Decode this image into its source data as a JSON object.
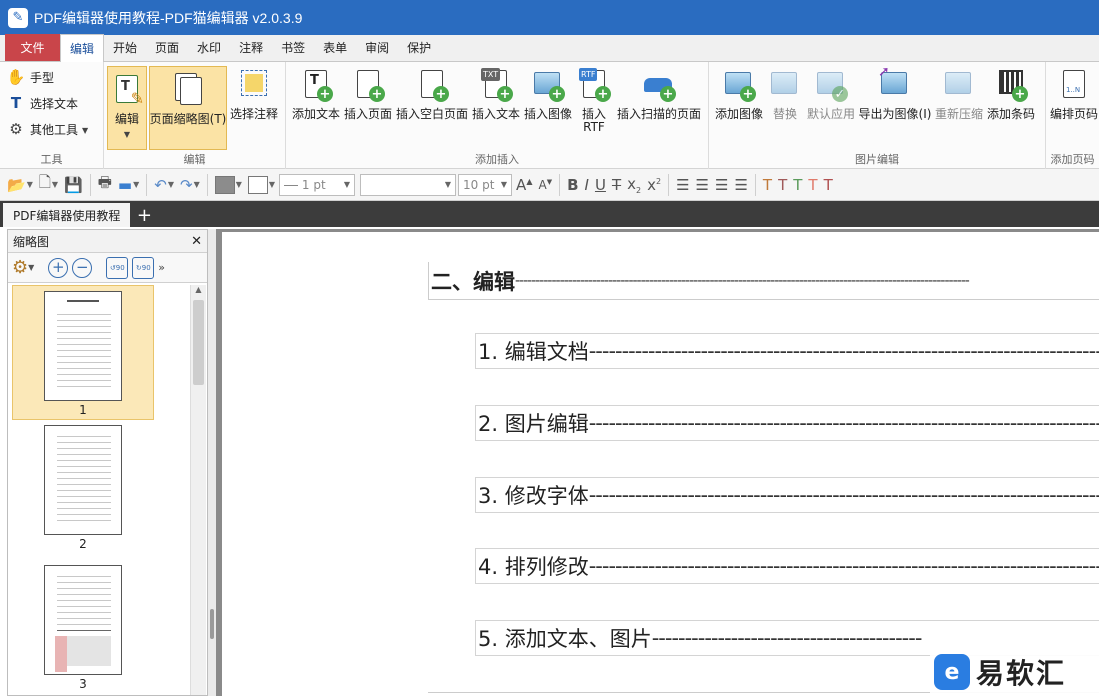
{
  "window": {
    "title": "PDF编辑器使用教程-PDF猫编辑器 v2.0.3.9"
  },
  "menu": {
    "file": "文件",
    "tabs": [
      "编辑",
      "开始",
      "页面",
      "水印",
      "注释",
      "书签",
      "表单",
      "审阅",
      "保护"
    ],
    "active": "编辑"
  },
  "ribbon": {
    "tools_group": {
      "label": "工具",
      "hand": "手型",
      "select_text": "选择文本",
      "other_tools": "其他工具"
    },
    "edit_group": {
      "label": "编辑",
      "edit": "编辑",
      "page_thumbnail": "页面缩略图(T)",
      "select_annotation": "选择注释"
    },
    "insert_group": {
      "label": "添加插入",
      "add_text": "添加文本",
      "insert_page": "插入页面",
      "insert_blank_page": "插入空白页面",
      "insert_text": "插入文本",
      "insert_image": "插入图像",
      "insert_rtf_line1": "插入",
      "insert_rtf_line2": "RTF",
      "insert_scanned_page": "插入扫描的页面"
    },
    "image_group": {
      "label": "图片编辑",
      "add_image": "添加图像",
      "replace": "替换",
      "default_apply": "默认应用",
      "export_as_image": "导出为图像(I)",
      "recompress": "重新压缩",
      "add_barcode": "添加条码"
    },
    "page_number_group": {
      "label": "添加页码",
      "edit_page_number": "编排页码"
    }
  },
  "format_toolbar": {
    "line_width": "1 pt",
    "font_name": "",
    "font_size": "10 pt",
    "colors": {
      "fill": "#8c8c8c",
      "stroke": "#ffffff"
    }
  },
  "doc_tabs": [
    {
      "label": "PDF编辑器使用教程"
    }
  ],
  "thumbnail_panel": {
    "title": "缩略图",
    "pages": [
      {
        "number": "1",
        "selected": true
      },
      {
        "number": "2",
        "selected": false
      },
      {
        "number": "3",
        "selected": false
      }
    ]
  },
  "document": {
    "heading": "二、编辑",
    "heading_dashes": "----------------------------------------------------------------------------------------------------------------",
    "toc": [
      {
        "text": "1.  编辑文档",
        "dashes": "--------------------------------------------------------------------------------------------"
      },
      {
        "text": "2.  图片编辑",
        "dashes": "--------------------------------------------------------------------------------------------"
      },
      {
        "text": "3.  修改字体",
        "dashes": "--------------------------------------------------------------------------------------------"
      },
      {
        "text": "4.  排列修改",
        "dashes": "--------------------------------------------------------------------------------------------"
      },
      {
        "text": "5.  添加文本、图片",
        "dashes": "-----------------------------------------"
      }
    ]
  },
  "watermark": {
    "logo_glyph": "e",
    "text": "易软汇"
  },
  "colors": {
    "titlebar": "#2a6cc0",
    "file_tab": "#c9454a",
    "selected": "#fbe3a5"
  }
}
